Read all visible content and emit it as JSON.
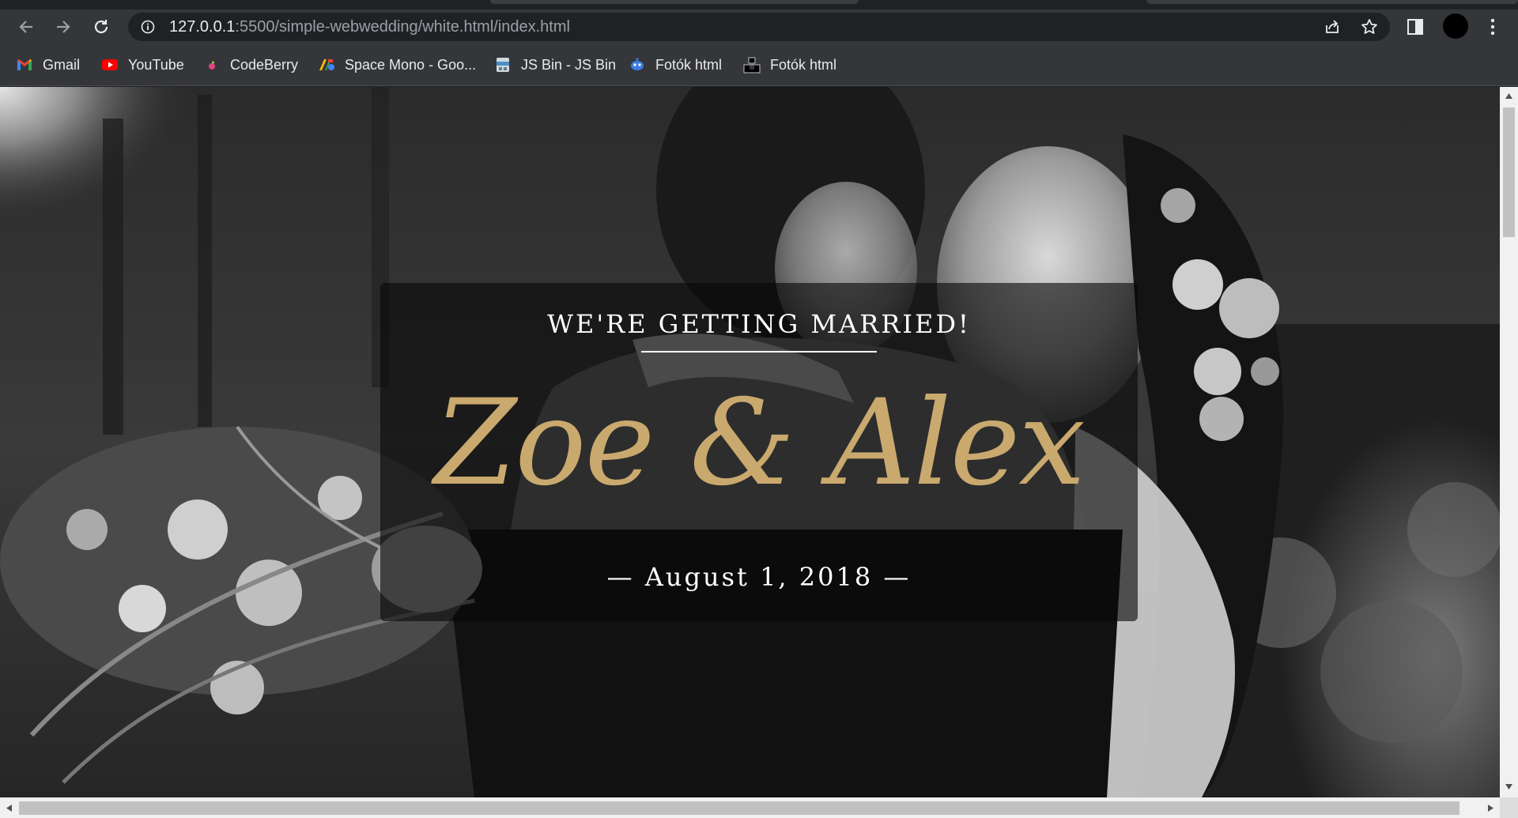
{
  "browser": {
    "url_host": "127.0.0.1",
    "url_path": ":5500/simple-webwedding/white.html/index.html",
    "bookmarks": [
      {
        "label": "Gmail",
        "icon": "gmail-icon"
      },
      {
        "label": "YouTube",
        "icon": "youtube-icon"
      },
      {
        "label": "CodeBerry",
        "icon": "codeberry-icon"
      },
      {
        "label": "Space Mono - Goo...",
        "icon": "google-fonts-icon"
      },
      {
        "label": "JS Bin - JS Bin",
        "icon": "jsbin-icon"
      },
      {
        "label": "Fotók html",
        "icon": "alien-icon"
      },
      {
        "label": "Fotók html",
        "icon": "unsplash-icon"
      }
    ]
  },
  "hero": {
    "kicker": "WE'RE GETTING MARRIED!",
    "names": "Zoe & Alex",
    "date": "— August 1, 2018 —",
    "accent_color": "#c9a96e"
  }
}
